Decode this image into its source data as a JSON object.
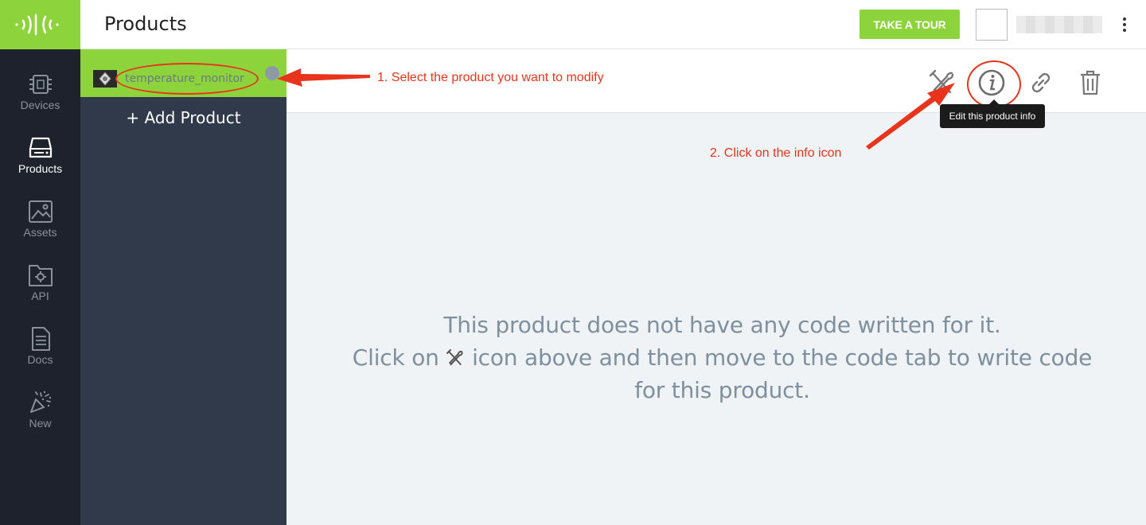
{
  "app": {
    "page_title": "Products",
    "accent_color": "#8dd33b",
    "annotation_color": "#e8341c"
  },
  "topbar": {
    "tour_button": "TAKE A TOUR",
    "menu_icon": "kebab-menu-icon"
  },
  "rail": {
    "items": [
      {
        "label": "Devices",
        "icon": "chip-icon"
      },
      {
        "label": "Products",
        "icon": "drive-icon",
        "active": true
      },
      {
        "label": "Assets",
        "icon": "image-icon"
      },
      {
        "label": "API",
        "icon": "folder-gear-icon"
      },
      {
        "label": "Docs",
        "icon": "document-icon"
      },
      {
        "label": "New",
        "icon": "confetti-icon"
      }
    ]
  },
  "sidebar": {
    "selected_product": "temperature_monitor",
    "add_product": "+ Add Product"
  },
  "toolbar": {
    "tools": [
      "wrench-screwdriver-icon",
      "info-icon",
      "link-icon",
      "trash-icon"
    ],
    "tooltip": "Edit this product info"
  },
  "annotations": {
    "step1": "1. Select the product you want to modify",
    "step2": "2. Click on the info icon"
  },
  "main": {
    "empty_line1": "This product does not have any code written for it.",
    "empty_line2_prefix": "Click on",
    "empty_line2_suffix": "icon above and then move to the code tab to write code",
    "empty_line3": "for this product."
  }
}
